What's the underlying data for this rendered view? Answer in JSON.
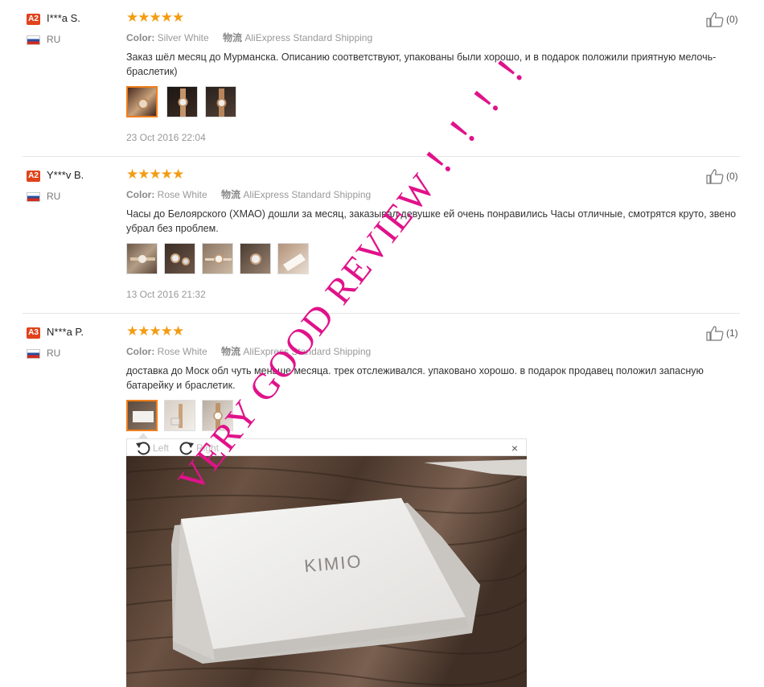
{
  "reviews": [
    {
      "badge": "A2",
      "user": "I***a S.",
      "country": "RU",
      "stars": "★★★★★",
      "color_label": "Color:",
      "color_value": "Silver White",
      "shipping_label": "物流",
      "shipping_value": "AliExpress Standard Shipping",
      "text": "Заказ шёл месяц до Мурманска. Описанию соответствуют, упакованы были хорошо, и в подарок положили приятную мелочь-браслетик)",
      "date": "23 Oct 2016 22:04",
      "helpful": "(0)"
    },
    {
      "badge": "A2",
      "user": "Y***v B.",
      "country": "RU",
      "stars": "★★★★★",
      "color_label": "Color:",
      "color_value": "Rose White",
      "shipping_label": "物流",
      "shipping_value": "AliExpress Standard Shipping",
      "text": "Часы до Белоярского (ХМАО) дошли за месяц, заказывал девушке ей очень понравились Часы отличные, смотрятся круто, звено убрал без проблем.",
      "date": "13 Oct 2016 21:32",
      "helpful": "(0)"
    },
    {
      "badge": "A3",
      "user": "N***a P.",
      "country": "RU",
      "stars": "★★★★★",
      "color_label": "Color:",
      "color_value": "Rose White",
      "shipping_label": "物流",
      "shipping_value": "AliExpress Standard Shipping",
      "text": "доставка до Моск обл чуть меньше месяца. трек отслеживался. упаковано хорошо. в подарок продавец положил запасную батарейку и браслетик.",
      "helpful": "(1)"
    }
  ],
  "viewer": {
    "rotate_left": "Left",
    "rotate_right": "Right",
    "close": "×",
    "brand_on_box": "KIMIO"
  },
  "watermark": {
    "text": "VERY GOOD REVIEW ！！！！",
    "color": "#e0128a"
  },
  "colors": {
    "badge": "#e0431b",
    "stars": "#f39c12",
    "selected_thumb": "#f07e1a"
  }
}
